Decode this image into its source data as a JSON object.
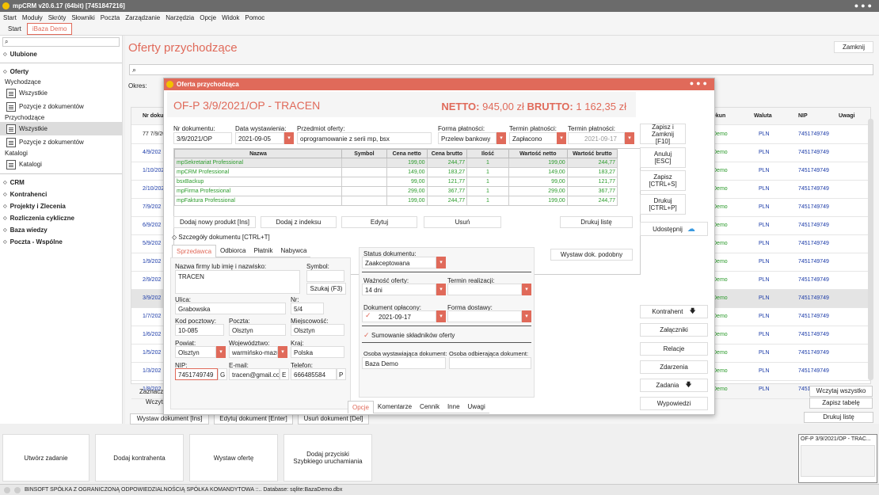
{
  "app": {
    "title": "mpCRM v20.6.17 (64bit) [7451847216]"
  },
  "menu": [
    "Start",
    "Moduły",
    "Skróty",
    "Słowniki",
    "Poczta",
    "Zarządzanie",
    "Narzędzia",
    "Opcje",
    "Widok",
    "Pomoc"
  ],
  "tabs": [
    {
      "label": "Start"
    },
    {
      "label": "iBaza Demo"
    }
  ],
  "sidebar": {
    "ulubione": "Ulubione",
    "oferty": "Oferty",
    "wychodzace": "Wychodzące",
    "wszystkie1": "Wszystkie",
    "pozycje1": "Pozycje z dokumentów",
    "przychodzace": "Przychodzące",
    "wszystkie2": "Wszystkie",
    "pozycje2": "Pozycje z dokumentów",
    "katalogi_group": "Katalogi",
    "katalogi": "Katalogi",
    "crm": "CRM",
    "kontrahenci": "Kontrahenci",
    "projekty": "Projekty i Zlecenia",
    "rozliczenia": "Rozliczenia cykliczne",
    "baza": "Baza wiedzy",
    "poczta": "Poczta - Wspólne"
  },
  "page": {
    "title": "Oferty przychodzące",
    "close": "Zamknij",
    "okres": "Okres:"
  },
  "bg_table": {
    "headers": {
      "nr": "Nr dokumentu",
      "kun": "ekun",
      "waluta": "Waluta",
      "nip": "NIP",
      "uwagi": "Uwagi"
    },
    "rows": [
      {
        "nr": "77 7/9/20",
        "kun": "Demo",
        "waluta": "PLN",
        "nip": "7451749749"
      },
      {
        "nr": "4/9/202",
        "kun": "Demo",
        "waluta": "PLN",
        "nip": "7451749749"
      },
      {
        "nr": "1/10/202",
        "kun": "Demo",
        "waluta": "PLN",
        "nip": "7451749749"
      },
      {
        "nr": "2/10/202",
        "kun": "Demo",
        "waluta": "PLN",
        "nip": "7451749749"
      },
      {
        "nr": "7/9/202",
        "kun": "Demo",
        "waluta": "PLN",
        "nip": "7451749749"
      },
      {
        "nr": "6/9/202",
        "kun": "Demo",
        "waluta": "PLN",
        "nip": "7451749749"
      },
      {
        "nr": "5/9/202",
        "kun": "Demo",
        "waluta": "PLN",
        "nip": "7451749749"
      },
      {
        "nr": "1/9/202",
        "kun": "Demo",
        "waluta": "PLN",
        "nip": "7451749749"
      },
      {
        "nr": "2/9/202",
        "kun": "Demo",
        "waluta": "PLN",
        "nip": "7451749749"
      },
      {
        "nr": "3/9/202",
        "kun": "Demo",
        "waluta": "PLN",
        "nip": "7451749749"
      },
      {
        "nr": "1/7/202",
        "kun": "Demo",
        "waluta": "PLN",
        "nip": "7451749749"
      },
      {
        "nr": "1/6/202",
        "kun": "Demo",
        "waluta": "PLN",
        "nip": "7451749749"
      },
      {
        "nr": "1/5/202",
        "kun": "Demo",
        "waluta": "PLN",
        "nip": "7451749749"
      },
      {
        "nr": "1/3/202",
        "kun": "Demo",
        "waluta": "PLN",
        "nip": "7451749749"
      },
      {
        "nr": "1/8/202",
        "kun": "Demo",
        "waluta": "PLN",
        "nip": "7451749749"
      }
    ],
    "zaznaczo": "Zaznaczo",
    "wczyta": "Wczyta",
    "wczytaj_wszystko": "Wczytaj wszystko",
    "zapisz_tabele": "Zapisz tabelę",
    "drukuj_liste": "Drukuj listę",
    "wystaw": "Wystaw dokument [Ins]",
    "edytuj": "Edytuj dokument [Enter]",
    "usun": "Usuń dokument [Del]"
  },
  "modal": {
    "title": "Oferta przychodząca",
    "doc_heading": "OF-P 3/9/2021/OP - TRACEN",
    "netto_label": "NETTO:",
    "netto_value": "945,00 zł",
    "brutto_label": "BRUTTO:",
    "brutto_value": "1 162,35 zł",
    "labels": {
      "nr": "Nr dokumentu:",
      "data": "Data wystawienia:",
      "przedmiot": "Przedmiot oferty:",
      "forma": "Forma płatności:",
      "termin1": "Termin płatności:",
      "termin2": "Termin płatności:"
    },
    "values": {
      "nr": "3/9/2021/OP",
      "data": "2021-09-05",
      "przedmiot": "oprogramowanie z serii mp, bsx",
      "forma": "Przelew bankowy",
      "status_plat": "Zapłacono",
      "termin": "2021-09-17"
    },
    "products": {
      "headers": [
        "Nazwa",
        "Symbol",
        "Cena netto",
        "Cena brutto",
        "Ilość",
        "Wartość netto",
        "Wartość brutto"
      ],
      "rows": [
        {
          "nazwa": "mpSekretariat Professional",
          "symbol": "",
          "netto": "199,00",
          "brutto": "244,77",
          "ilosc": "1",
          "wnetto": "199,00",
          "wbrutto": "244,77"
        },
        {
          "nazwa": "mpCRM Professional",
          "symbol": "",
          "netto": "149,00",
          "brutto": "183,27",
          "ilosc": "1",
          "wnetto": "149,00",
          "wbrutto": "183,27"
        },
        {
          "nazwa": "bsxBackup",
          "symbol": "",
          "netto": "99,00",
          "brutto": "121,77",
          "ilosc": "1",
          "wnetto": "99,00",
          "wbrutto": "121,77"
        },
        {
          "nazwa": "mpFirma Professional",
          "symbol": "",
          "netto": "299,00",
          "brutto": "367,77",
          "ilosc": "1",
          "wnetto": "299,00",
          "wbrutto": "367,77"
        },
        {
          "nazwa": "mpFaktura Professional",
          "symbol": "",
          "netto": "199,00",
          "brutto": "244,77",
          "ilosc": "1",
          "wnetto": "199,00",
          "wbrutto": "244,77"
        }
      ]
    },
    "buttons": {
      "dodaj_produkt": "Dodaj nowy produkt [Ins]",
      "dodaj_indeks": "Dodaj z indeksu",
      "edytuj": "Edytuj",
      "usun": "Usuń",
      "drukuj_liste": "Drukuj listę",
      "szczegoly": "Szczegóły dokumentu [CTRL+T]",
      "szukaj": "Szukaj (F3)",
      "wystaw_podobny": "Wystaw dok. podobny"
    },
    "side": {
      "zapisz_zamknij": "Zapisz i Zamknij",
      "zapisz_zamknij_key": "[F10]",
      "anuluj": "Anuluj",
      "anuluj_key": "[ESC]",
      "zapisz": "Zapisz",
      "zapisz_key": "[CTRL+S]",
      "drukuj": "Drukuj",
      "drukuj_key": "[CTRL+P]",
      "udostepnij": "Udostępnij",
      "kontrahent": "Kontrahent",
      "zalaczniki": "Załączniki",
      "relacje": "Relacje",
      "zdarzenia": "Zdarzenia",
      "zadania": "Zadania",
      "wypowiedzi": "Wypowiedzi"
    },
    "party_tabs": [
      "Sprzedawca",
      "Odbiorca",
      "Płatnik",
      "Nabywca"
    ],
    "seller": {
      "l_nazwa": "Nazwa firmy lub imię i nazwisko:",
      "l_symbol": "Symbol:",
      "nazwa": "TRACEN",
      "l_ulica": "Ulica:",
      "l_nr": "Nr:",
      "ulica": "Grabowska",
      "nr": "5/4",
      "l_kod": "Kod pocztowy:",
      "l_poczta": "Poczta:",
      "l_miejsc": "Miejscowość:",
      "kod": "10-085",
      "poczta": "Olsztyn",
      "miejsc": "Olsztyn",
      "l_powiat": "Powiat:",
      "l_woj": "Województwo:",
      "l_kraj": "Kraj:",
      "powiat": "Olsztyn",
      "woj": "warmińsko-mazu",
      "kraj": "Polska",
      "l_nip": "NIP:",
      "l_email": "E-mail:",
      "l_tel": "Telefon:",
      "nip": "7451749749",
      "nip_btn": "G",
      "email": "tracen@gmail.cor",
      "email_btn": "E",
      "tel": "666485584",
      "tel_btn": "P"
    },
    "status": {
      "l_status": "Status dokumentu:",
      "status": "Zaakceptowana",
      "l_waznosc": "Ważność oferty:",
      "waznosc": "14 dni",
      "l_termin": "Termin realizacji:",
      "l_oplacony": "Dokument opłacony:",
      "oplacony": "2021-09-17",
      "l_dostawa": "Forma dostawy:",
      "sumowanie": "Sumowanie składników oferty",
      "l_osoba_w": "Osoba wystawiająca dokument:",
      "l_osoba_o": "Osoba odbierająca dokument:",
      "osoba_w": "Baza Demo"
    },
    "bottom_tabs": [
      "Opcje",
      "Komentarze",
      "Cennik",
      "Inne",
      "Uwagi"
    ]
  },
  "quick": {
    "zadanie": "Utwórz zadanie",
    "kontrahent": "Dodaj kontrahenta",
    "oferte": "Wystaw ofertę",
    "przyciski": "Dodaj przyciski Szybkiego uruchamiania",
    "thumb": "OF-P 3/9/2021/OP - TRAC..."
  },
  "statusbar": "BINSOFT SPÓŁKA Z OGRANICZONĄ ODPOWIEDZIALNOŚCIĄ SPÓŁKA KOMANDYTOWA ::.. Database: sqlite:BazaDemo.dbx",
  "colors": {
    "accent": "#e06a5a",
    "green": "#2a9a2a"
  }
}
